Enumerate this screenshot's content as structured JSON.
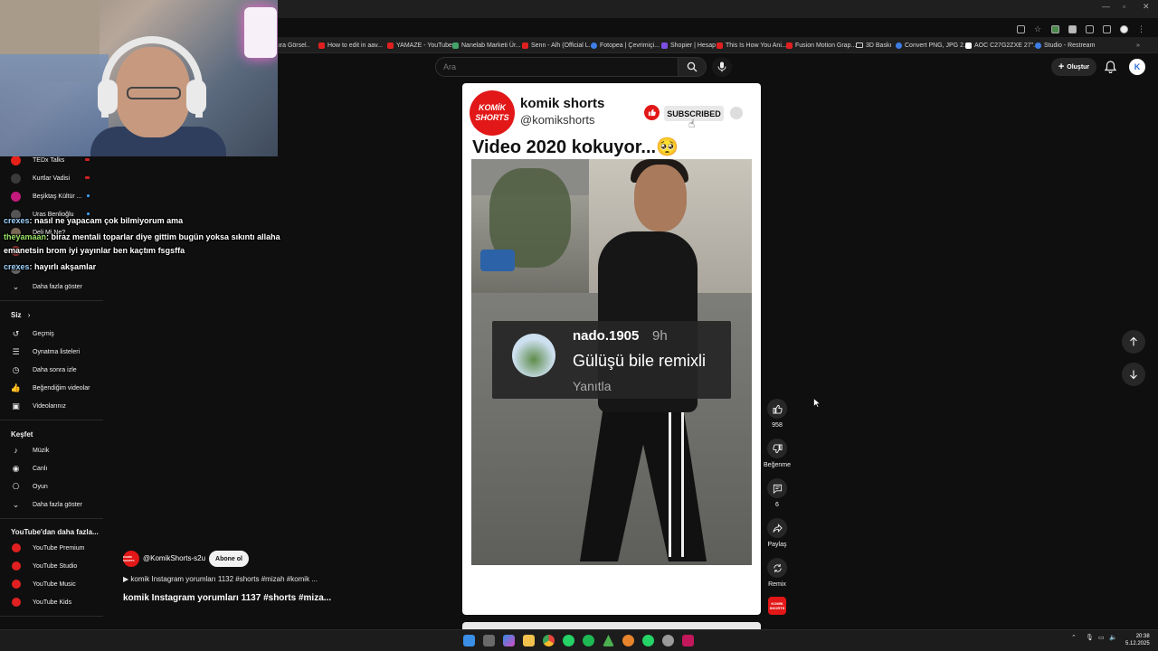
{
  "browser": {
    "bookmarks": [
      {
        "label": "...ıra Görsel..",
        "icon": "site-icon"
      },
      {
        "label": "How to edit in aav...",
        "icon": "youtube-icon"
      },
      {
        "label": "YAMAZE - YouTube",
        "icon": "youtube-icon"
      },
      {
        "label": "Nanelab Marketi Ür...",
        "icon": "site-icon"
      },
      {
        "label": "Senn - Alh (Official L...",
        "icon": "youtube-icon"
      },
      {
        "label": "Fotopea | Çevrimiçi...",
        "icon": "site-icon"
      },
      {
        "label": "Shopier | Hesap",
        "icon": "site-icon"
      },
      {
        "label": "This Is How You Ani...",
        "icon": "youtube-icon"
      },
      {
        "label": "Fusion Motion Grap...",
        "icon": "youtube-icon"
      },
      {
        "label": "3D Baskı",
        "icon": "folder-icon"
      },
      {
        "label": "Convert PNG, JPG 2...",
        "icon": "site-icon"
      },
      {
        "label": "AOC C27G2ZXE 27\"...",
        "icon": "site-icon"
      },
      {
        "label": "Studio - Restream",
        "icon": "site-icon"
      }
    ]
  },
  "topbar": {
    "search_placeholder": "Ara",
    "create_label": "Oluştur",
    "avatar_letter": "K"
  },
  "sidebar": {
    "subscriptions": [
      {
        "label": "TEDx Talks",
        "color": "#e62117",
        "indicator": "live"
      },
      {
        "label": "Kurtlar Vadisi",
        "color": "#3a3a3a",
        "indicator": "live"
      },
      {
        "label": "Beşiktaş Kültür ...",
        "color": "#c31a7b",
        "indicator": "new"
      },
      {
        "label": "Uras Benlioğlu",
        "color": "#555555",
        "indicator": "new"
      },
      {
        "label": "Deli Mi Ne?",
        "color": "#7a6a55",
        "indicator": "none"
      },
      {
        "label": "",
        "color": "#8a3030",
        "indicator": "none"
      },
      {
        "label": "",
        "color": "#666666",
        "indicator": "none"
      }
    ],
    "show_more_1": "Daha fazla göster",
    "you_title": "Siz",
    "you_items": [
      {
        "label": "Geçmiş",
        "icon": "history-icon"
      },
      {
        "label": "Oynatma listeleri",
        "icon": "playlists-icon"
      },
      {
        "label": "Daha sonra izle",
        "icon": "watch-later-icon"
      },
      {
        "label": "Beğendiğim videolar",
        "icon": "liked-icon"
      },
      {
        "label": "Videolarınız",
        "icon": "your-videos-icon"
      }
    ],
    "explore_title": "Keşfet",
    "explore_items": [
      {
        "label": "Müzik",
        "icon": "music-icon"
      },
      {
        "label": "Canlı",
        "icon": "live-icon"
      },
      {
        "label": "Oyun",
        "icon": "gaming-icon"
      }
    ],
    "show_more_2": "Daha fazla göster",
    "more_title": "YouTube'dan daha fazla...",
    "more_items": [
      {
        "label": "YouTube Premium"
      },
      {
        "label": "YouTube Studio"
      },
      {
        "label": "YouTube Music"
      },
      {
        "label": "YouTube Kids"
      }
    ]
  },
  "chat": [
    {
      "user": "crexes",
      "text": ": nasıl ne yapacam çok bilmiyorum ama"
    },
    {
      "user": "theyamaan",
      "text": ": biraz mentali toparlar diye gittim bugün yoksa sıkıntı allaha"
    },
    {
      "user": "",
      "text": "emanetsin brom iyi yayınlar ben kaçtım fsgsffa"
    },
    {
      "user": "crexes",
      "text": ": hayırlı akşamlar"
    }
  ],
  "video": {
    "channel_logo_line1": "KOMİK",
    "channel_logo_line2": "SHORTS",
    "channel_name": "komik shorts",
    "channel_handle": "@komikshorts",
    "subscribed_label": "SUBSCRIBED",
    "title": "Video 2020 kokuyor...🥺",
    "comment_user": "nado.1905",
    "comment_time": "9h",
    "comment_text": "Gülüşü bile remixli",
    "comment_reply": "Yanıtla"
  },
  "actions": {
    "likes": "958",
    "dislike_label": "Beğenme",
    "comments": "6",
    "share_label": "Paylaş",
    "remix_label": "Remix",
    "channel_mini_text": "KOMİK SHORTS"
  },
  "info": {
    "avatar_text": "KOMİK SHORTS",
    "handle": "@KomikShorts-s2u",
    "subscribe_label": "Abone ol",
    "description": "▶ komik Instagram yorumları 1132 #shorts #mizah #komik ...",
    "title": "komik Instagram yorumları 1137 #shorts #miza..."
  },
  "taskbar": {
    "time": "20:38",
    "date": "5.12.2025"
  }
}
